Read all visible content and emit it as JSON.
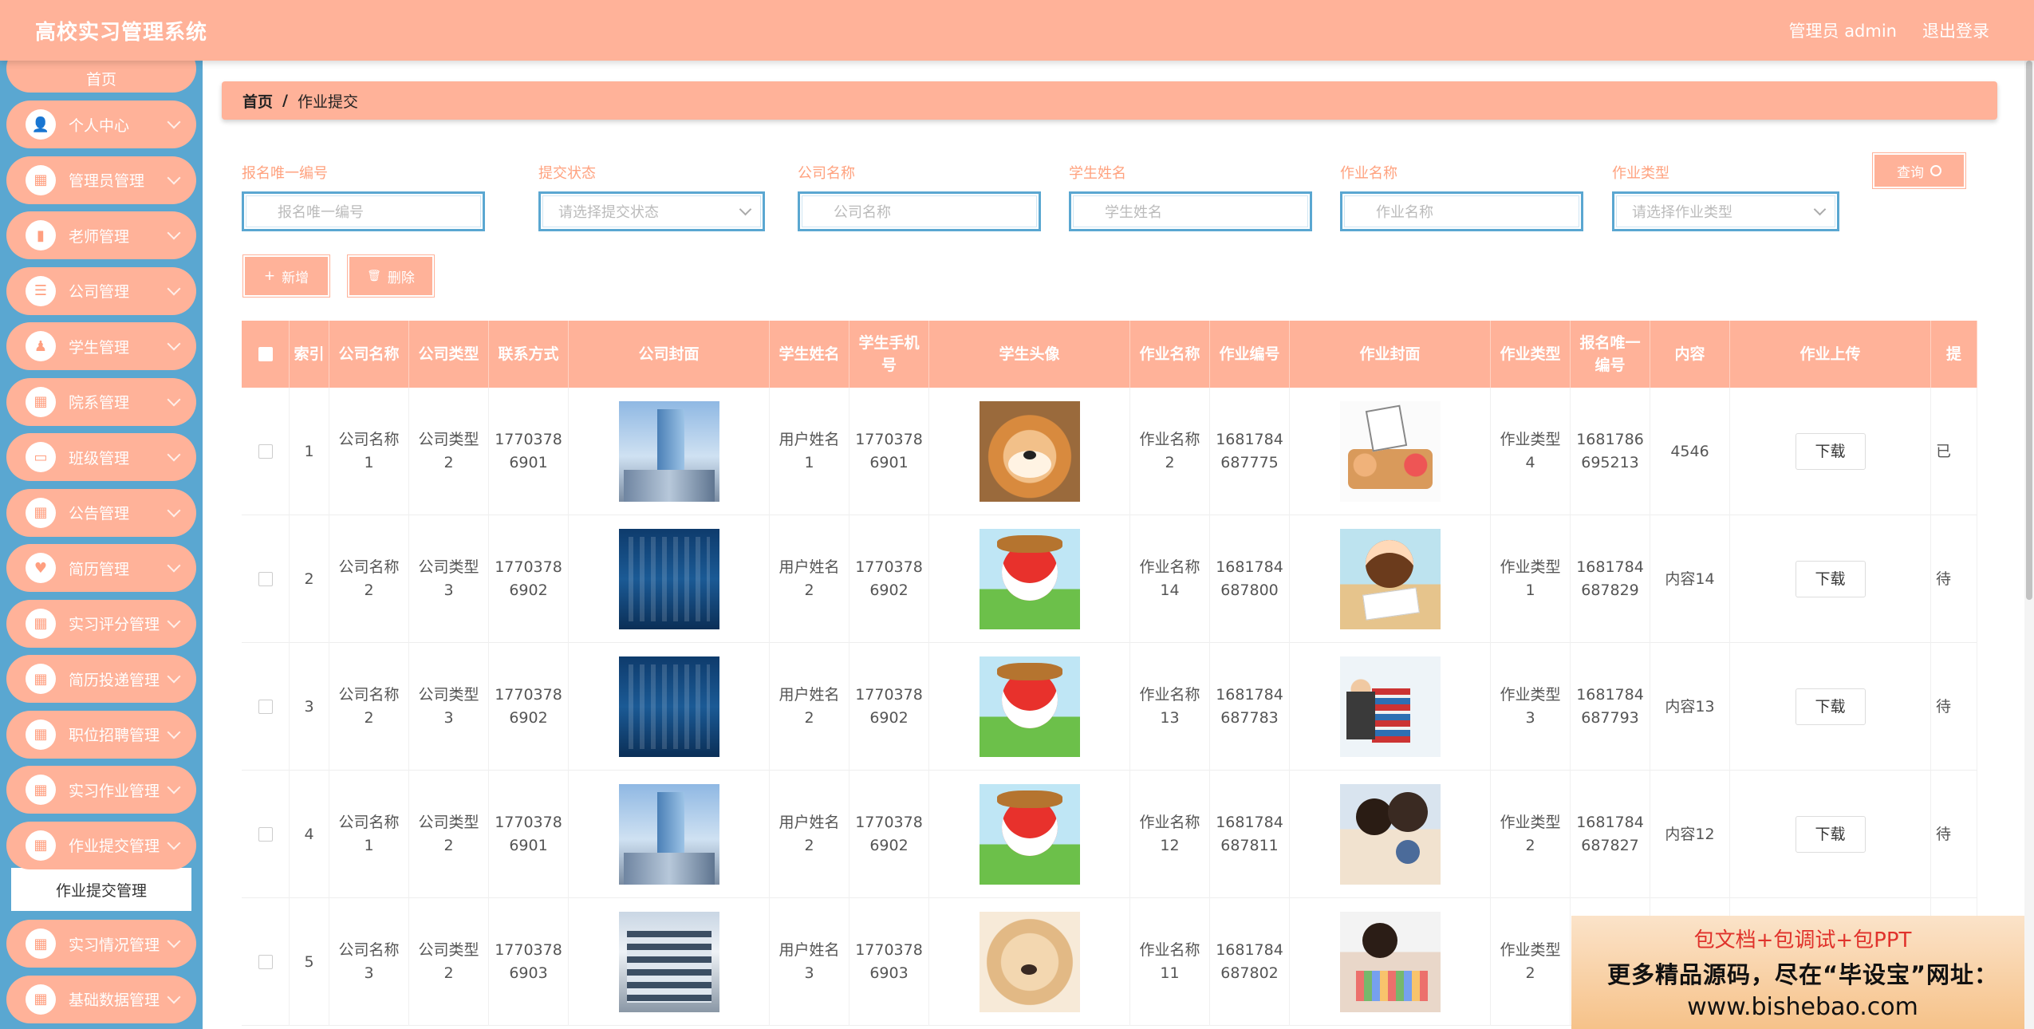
{
  "header": {
    "title": "高校实习管理系统",
    "user": "管理员 admin",
    "logout": "退出登录"
  },
  "sidebar": {
    "home": "首页",
    "items": [
      {
        "label": "个人中心",
        "icon": "user-icon"
      },
      {
        "label": "管理员管理",
        "icon": "grid-icon"
      },
      {
        "label": "老师管理",
        "icon": "bar-chart-icon"
      },
      {
        "label": "公司管理",
        "icon": "list-icon"
      },
      {
        "label": "学生管理",
        "icon": "shirt-icon"
      },
      {
        "label": "院系管理",
        "icon": "grid-icon"
      },
      {
        "label": "班级管理",
        "icon": "id-card-icon"
      },
      {
        "label": "公告管理",
        "icon": "grid-icon"
      },
      {
        "label": "简历管理",
        "icon": "heart-icon"
      },
      {
        "label": "实习评分管理",
        "icon": "grid-icon"
      },
      {
        "label": "简历投递管理",
        "icon": "grid-icon"
      },
      {
        "label": "职位招聘管理",
        "icon": "grid-icon"
      },
      {
        "label": "实习作业管理",
        "icon": "grid-icon"
      },
      {
        "label": "作业提交管理",
        "icon": "grid-icon"
      },
      {
        "label": "实习情况管理",
        "icon": "grid-icon"
      },
      {
        "label": "基础数据管理",
        "icon": "grid-icon"
      }
    ],
    "active_sub": "作业提交管理"
  },
  "breadcrumb": {
    "home": "首页",
    "sep": "/",
    "current": "作业提交"
  },
  "search": {
    "fields": [
      {
        "label": "报名唯一编号",
        "placeholder": "报名唯一编号",
        "type": "input"
      },
      {
        "label": "提交状态",
        "placeholder": "请选择提交状态",
        "type": "select"
      },
      {
        "label": "公司名称",
        "placeholder": "公司名称",
        "type": "input"
      },
      {
        "label": "学生姓名",
        "placeholder": "学生姓名",
        "type": "input"
      },
      {
        "label": "作业名称",
        "placeholder": "作业名称",
        "type": "input"
      },
      {
        "label": "作业类型",
        "placeholder": "请选择作业类型",
        "type": "select"
      }
    ],
    "query": "查询"
  },
  "actions": {
    "add": "新增",
    "delete": "删除",
    "add_icon": "+",
    "delete_icon": "🗑"
  },
  "table": {
    "columns": [
      "",
      "索引",
      "公司名称",
      "公司类型",
      "联系方式",
      "公司封面",
      "学生姓名",
      "学生手机号",
      "学生头像",
      "作业名称",
      "作业编号",
      "作业封面",
      "作业类型",
      "报名唯一编号",
      "内容",
      "作业上传",
      "提"
    ],
    "download_label": "下载",
    "rows": [
      {
        "idx": "1",
        "company": "公司名称1",
        "ctype": "公司类型2",
        "contact": "17703786901",
        "cover": "img-bldg-a",
        "student": "用户姓名1",
        "phone": "17703786901",
        "avatar": "img-dog",
        "hw": "作业名称2",
        "hwno": "1681784687775",
        "hwcover": "img-hw1",
        "hwtype": "作业类型4",
        "regno": "1681786695213",
        "content": "4546",
        "status": "已"
      },
      {
        "idx": "2",
        "company": "公司名称2",
        "ctype": "公司类型3",
        "contact": "17703786902",
        "cover": "img-bldg-b",
        "student": "用户姓名2",
        "phone": "17703786902",
        "avatar": "img-cartoon",
        "hw": "作业名称14",
        "hwno": "1681784687800",
        "hwcover": "img-hw2",
        "hwtype": "作业类型1",
        "regno": "1681784687829",
        "content": "内容14",
        "status": "待"
      },
      {
        "idx": "3",
        "company": "公司名称2",
        "ctype": "公司类型3",
        "contact": "17703786902",
        "cover": "img-bldg-b",
        "student": "用户姓名2",
        "phone": "17703786902",
        "avatar": "img-cartoon",
        "hw": "作业名称13",
        "hwno": "1681784687783",
        "hwcover": "img-hw3",
        "hwtype": "作业类型3",
        "regno": "1681784687793",
        "content": "内容13",
        "status": "待"
      },
      {
        "idx": "4",
        "company": "公司名称1",
        "ctype": "公司类型2",
        "contact": "17703786901",
        "cover": "img-bldg-a",
        "student": "用户姓名2",
        "phone": "17703786902",
        "avatar": "img-cartoon",
        "hw": "作业名称12",
        "hwno": "1681784687811",
        "hwcover": "img-hw4",
        "hwtype": "作业类型2",
        "regno": "1681784687827",
        "content": "内容12",
        "status": "待"
      },
      {
        "idx": "5",
        "company": "公司名称3",
        "ctype": "公司类型2",
        "contact": "17703786903",
        "cover": "img-bldg-c",
        "student": "用户姓名3",
        "phone": "17703786903",
        "avatar": "img-puppy",
        "hw": "作业名称11",
        "hwno": "1681784687802",
        "hwcover": "img-hw5",
        "hwtype": "作业类型2",
        "regno": "",
        "content": "",
        "status": ""
      }
    ]
  },
  "watermark": {
    "line1": "包文档+包调试+包PPT",
    "line2": "更多精品源码，尽在“毕设宝”网址：",
    "line3": "www.bishebao.com"
  },
  "colors": {
    "accent": "#ffb299",
    "sidebar": "#5aa7d1",
    "label": "#ffa27f"
  }
}
